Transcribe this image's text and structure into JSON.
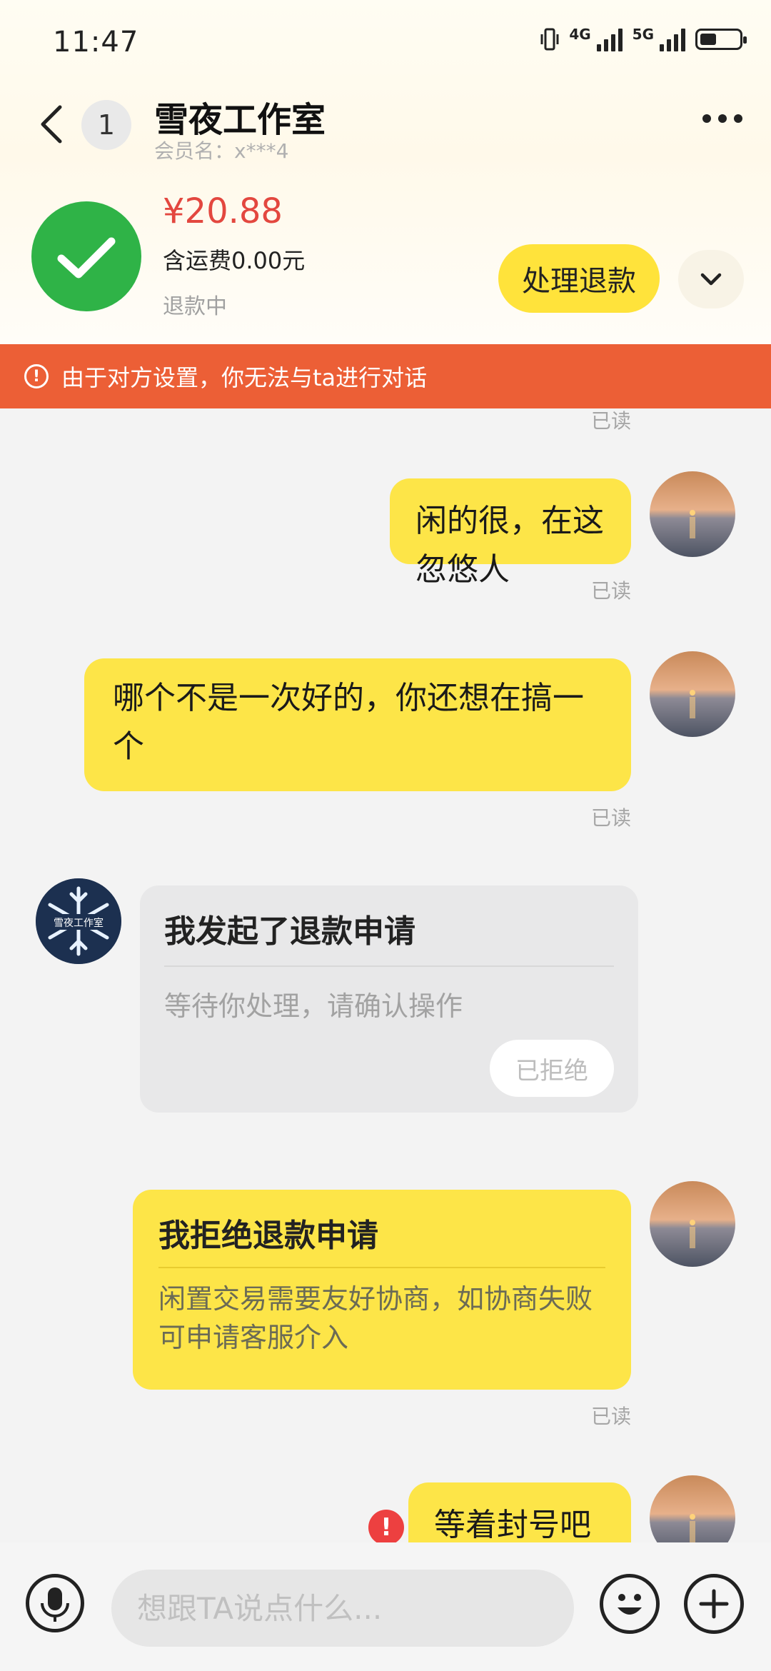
{
  "status_bar": {
    "time": "11:47",
    "network_1": "4G",
    "network_2": "5G",
    "icons": [
      "vibrate-icon",
      "signal-icon",
      "battery-icon"
    ]
  },
  "header": {
    "unread_count": "1",
    "shop_name": "雪夜工作室",
    "member_label": "会员名：x***4"
  },
  "order": {
    "price": "¥20.88",
    "shipping": "含运费0.00元",
    "status": "退款中",
    "action_button": "处理退款",
    "accent_color": "#ffe33b"
  },
  "banner": {
    "text": "由于对方设置，你无法与ta进行对话",
    "color": "#ec5f36"
  },
  "messages": [
    {
      "from": "me",
      "text": "闲的很，在这忽悠人",
      "read": "已读"
    },
    {
      "from": "me",
      "text": "哪个不是一次好的，你还想在搞一个",
      "read": "已读"
    },
    {
      "from": "shop",
      "card_title": "我发起了退款申请",
      "card_desc": "等待你处理，请确认操作",
      "card_action": "已拒绝",
      "avatar_text": "雪夜工作室"
    },
    {
      "from": "me",
      "card_title": "我拒绝退款申请",
      "card_desc": "闲置交易需要友好协商，如协商失败可申请客服介入",
      "read": "已读"
    },
    {
      "from": "me",
      "text": "等着封号吧",
      "failed": true
    }
  ],
  "top_read": "已读",
  "input": {
    "placeholder": "想跟TA说点什么..."
  }
}
